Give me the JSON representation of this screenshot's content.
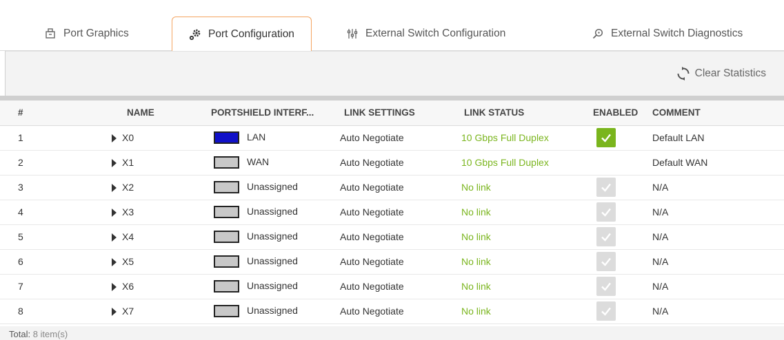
{
  "tabs": [
    {
      "label": "Port Graphics",
      "icon": "port-graphics-icon"
    },
    {
      "label": "Port Configuration",
      "icon": "gear-icon"
    },
    {
      "label": "External Switch Configuration",
      "icon": "sliders-icon"
    },
    {
      "label": "External Switch Diagnostics",
      "icon": "magnifier-icon"
    }
  ],
  "active_tab": "Port Configuration",
  "toolbar": {
    "clear_label": "Clear Statistics"
  },
  "table": {
    "headers": [
      "#",
      "NAME",
      "PORTSHIELD INTERF...",
      "LINK SETTINGS",
      "LINK STATUS",
      "ENABLED",
      "COMMENT"
    ],
    "rows": [
      {
        "num": "1",
        "name": "X0",
        "ps": "LAN",
        "ps_color": "#1010c8",
        "ls": "Auto Negotiate",
        "status": "10 Gbps Full Duplex",
        "enabled": "on",
        "comment": "Default LAN"
      },
      {
        "num": "2",
        "name": "X1",
        "ps": "WAN",
        "ps_color": "#c8c8c8",
        "ls": "Auto Negotiate",
        "status": "10 Gbps Full Duplex",
        "enabled": "none",
        "comment": "Default WAN"
      },
      {
        "num": "3",
        "name": "X2",
        "ps": "Unassigned",
        "ps_color": "#c8c8c8",
        "ls": "Auto Negotiate",
        "status": "No link",
        "enabled": "off",
        "comment": "N/A"
      },
      {
        "num": "4",
        "name": "X3",
        "ps": "Unassigned",
        "ps_color": "#c8c8c8",
        "ls": "Auto Negotiate",
        "status": "No link",
        "enabled": "off",
        "comment": "N/A"
      },
      {
        "num": "5",
        "name": "X4",
        "ps": "Unassigned",
        "ps_color": "#c8c8c8",
        "ls": "Auto Negotiate",
        "status": "No link",
        "enabled": "off",
        "comment": "N/A"
      },
      {
        "num": "6",
        "name": "X5",
        "ps": "Unassigned",
        "ps_color": "#c8c8c8",
        "ls": "Auto Negotiate",
        "status": "No link",
        "enabled": "off",
        "comment": "N/A"
      },
      {
        "num": "7",
        "name": "X6",
        "ps": "Unassigned",
        "ps_color": "#c8c8c8",
        "ls": "Auto Negotiate",
        "status": "No link",
        "enabled": "off",
        "comment": "N/A"
      },
      {
        "num": "8",
        "name": "X7",
        "ps": "Unassigned",
        "ps_color": "#c8c8c8",
        "ls": "Auto Negotiate",
        "status": "No link",
        "enabled": "off",
        "comment": "N/A"
      }
    ]
  },
  "footer": {
    "label": "Total:",
    "value": "8 item(s)"
  },
  "colors": {
    "accent_tab": "#f4a460",
    "link_green": "#7ab51d"
  }
}
